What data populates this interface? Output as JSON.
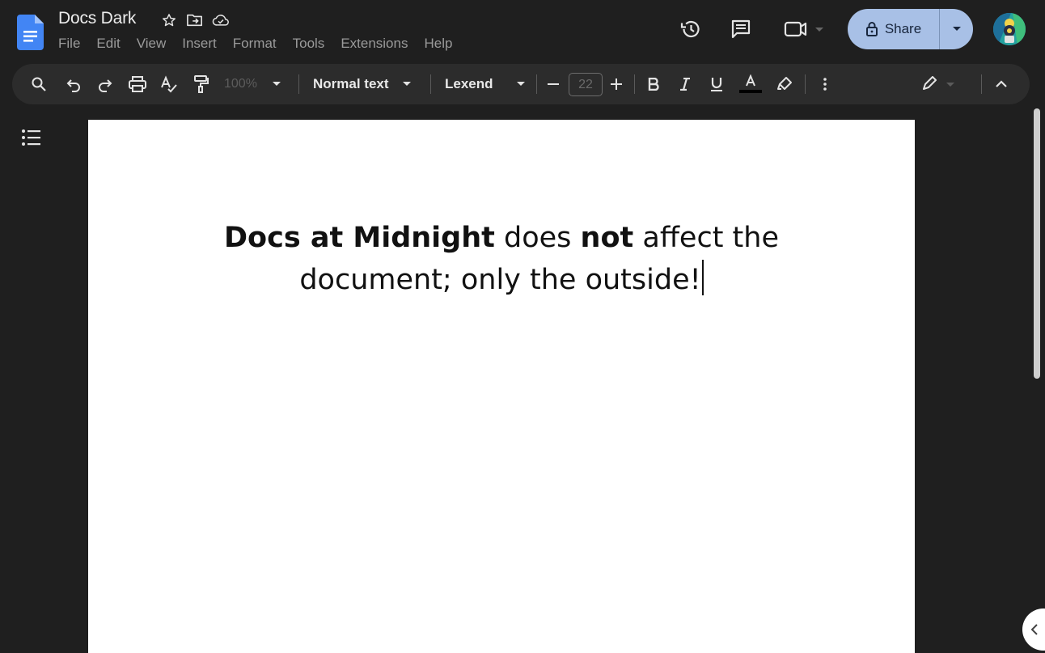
{
  "app": {
    "title": "Docs Dark"
  },
  "menubar": {
    "items": [
      "File",
      "Edit",
      "View",
      "Insert",
      "Format",
      "Tools",
      "Extensions",
      "Help"
    ]
  },
  "header": {
    "share_label": "Share"
  },
  "toolbar": {
    "zoom": "100%",
    "style": "Normal text",
    "font": "Lexend",
    "font_size": "22"
  },
  "document": {
    "line1_bold1": "Docs at Midnight",
    "line1_text1": " does ",
    "line1_bold2": "not",
    "line1_text2": " affect the",
    "line2_text": "document; only the outside!"
  },
  "colors": {
    "background": "#1f1f1f",
    "toolbar": "#2c2c2c",
    "share_button": "#a8c0e6",
    "docs_blue": "#4285f4"
  }
}
